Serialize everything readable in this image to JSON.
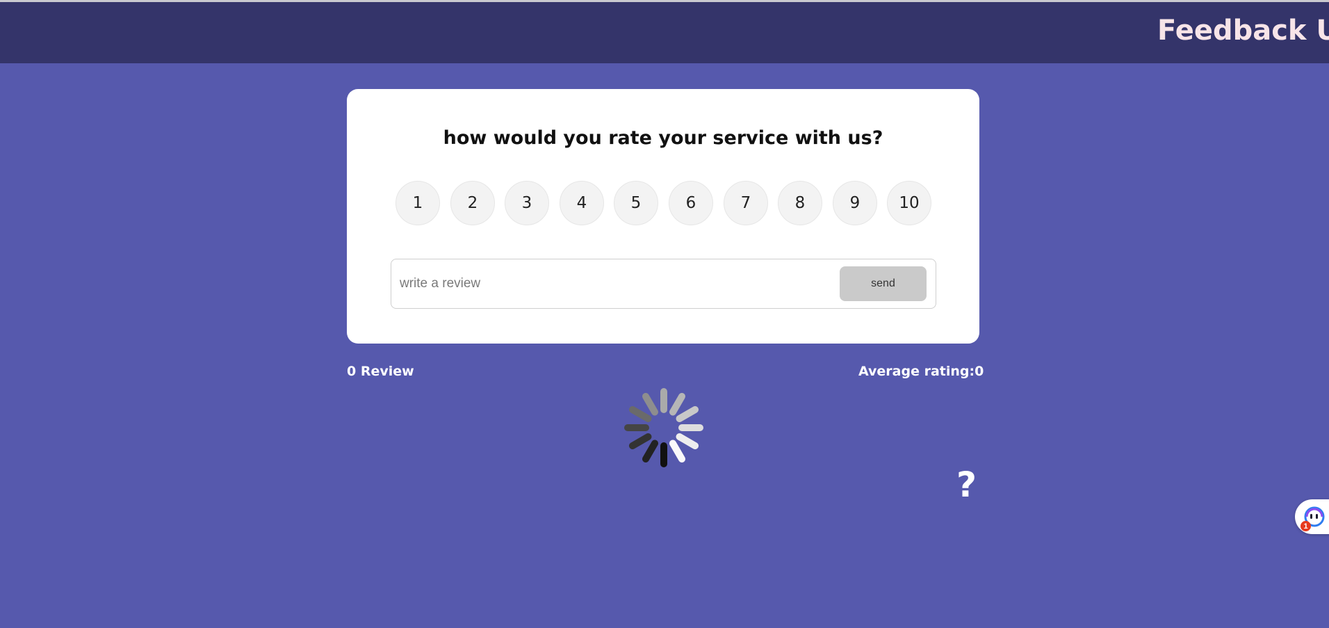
{
  "header": {
    "title": "Feedback UI"
  },
  "card": {
    "question": "how would you rate your service with us?",
    "ratings": [
      "1",
      "2",
      "3",
      "4",
      "5",
      "6",
      "7",
      "8",
      "9",
      "10"
    ],
    "review_placeholder": "write a review",
    "review_value": "",
    "send_label": "send"
  },
  "stats": {
    "review_count": "0 Review",
    "average_rating": "Average rating:0"
  },
  "help": {
    "label": "?"
  },
  "assistant": {
    "badge_count": "1",
    "icon": "chat-face-icon"
  },
  "colors": {
    "page_background": "#5659ad",
    "header_background": "#34346a",
    "header_text": "#f7e4e8",
    "send_button": "#cacaca",
    "badge": "#e63a1e"
  }
}
